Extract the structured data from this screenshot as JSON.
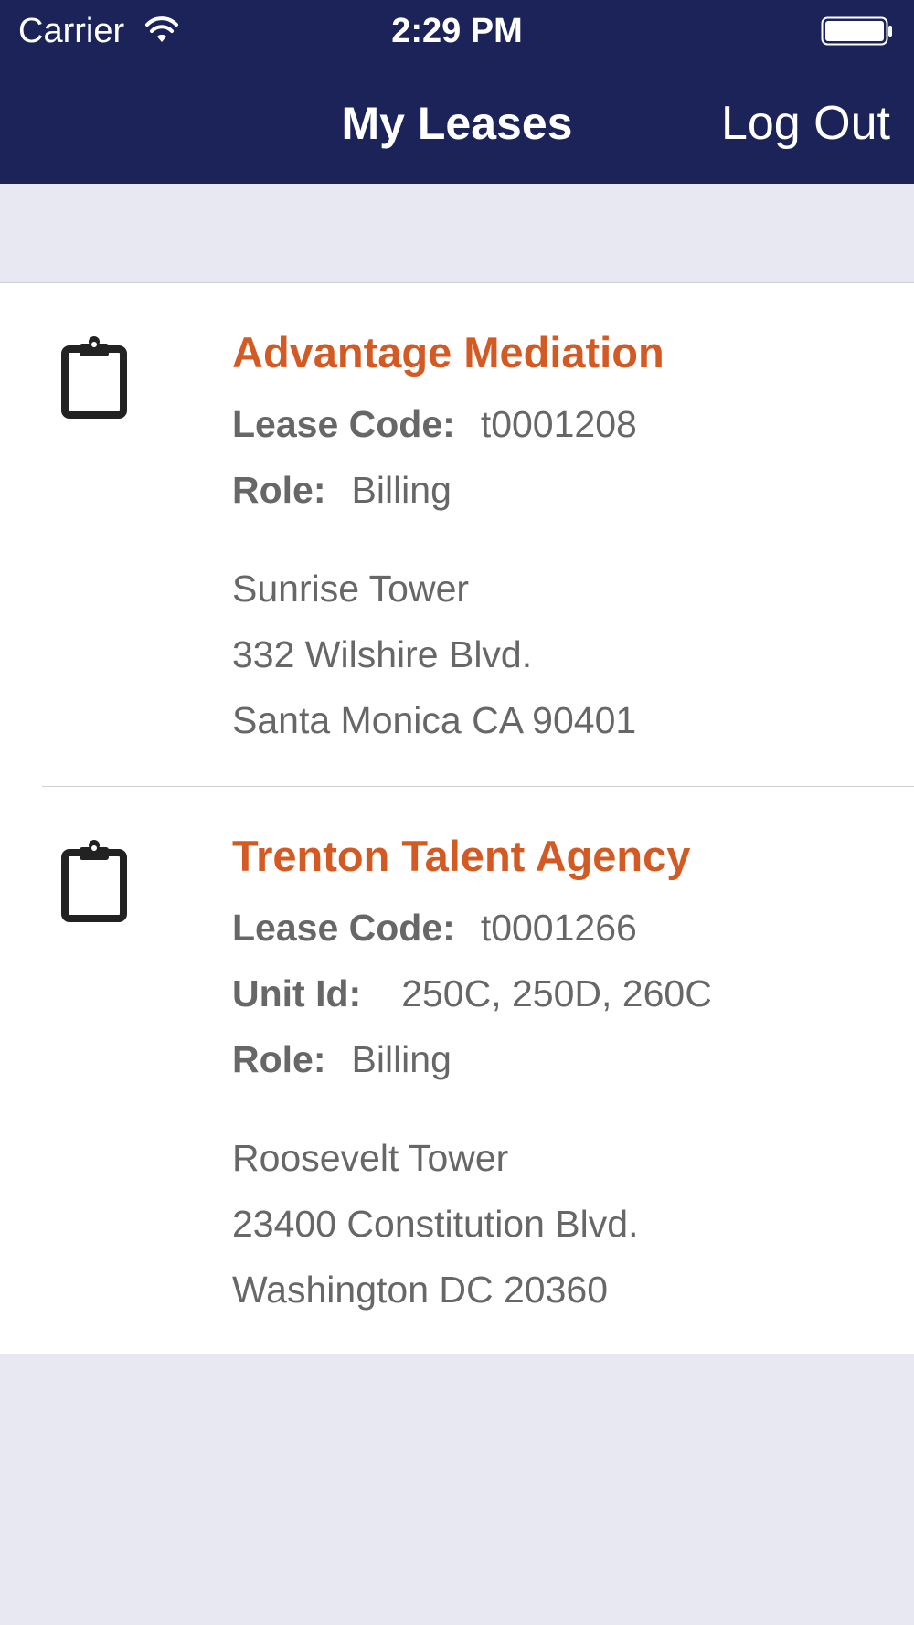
{
  "status_bar": {
    "carrier": "Carrier",
    "time": "2:29 PM"
  },
  "nav": {
    "title": "My Leases",
    "logout_label": "Log Out"
  },
  "colors": {
    "header_bg": "#1b2359",
    "accent": "#d35a23",
    "text": "#676767",
    "page_bg": "#e8e8f2"
  },
  "leases": [
    {
      "company": "Advantage Mediation",
      "lease_code_label": "Lease Code:",
      "lease_code": "t0001208",
      "role_label": "Role:",
      "role": "Billing",
      "address": {
        "building": "Sunrise Tower",
        "street": "332 Wilshire Blvd.",
        "city_line": "Santa Monica CA 90401"
      },
      "icon": "clipboard-icon"
    },
    {
      "company": "Trenton Talent Agency",
      "lease_code_label": "Lease Code:",
      "lease_code": "t0001266",
      "unit_label": "Unit Id:",
      "unit_id": "250C, 250D, 260C",
      "role_label": "Role:",
      "role": "Billing",
      "address": {
        "building": "Roosevelt Tower",
        "street": "23400 Constitution Blvd.",
        "city_line": "Washington DC 20360"
      },
      "icon": "clipboard-icon"
    }
  ]
}
